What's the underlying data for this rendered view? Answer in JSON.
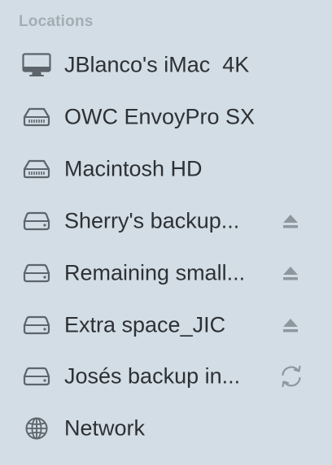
{
  "sidebar": {
    "header": "Locations",
    "items": [
      {
        "label": "JBlanco's iMac  4K",
        "icon": "imac-icon"
      },
      {
        "label": "OWC EnvoyPro SX",
        "icon": "internal-drive-icon"
      },
      {
        "label": "Macintosh HD",
        "icon": "internal-drive-icon"
      },
      {
        "label": "Sherry's backup...",
        "icon": "external-drive-icon",
        "accessory": "eject-icon"
      },
      {
        "label": "Remaining small...",
        "icon": "external-drive-icon",
        "accessory": "eject-icon"
      },
      {
        "label": "Extra space_JIC",
        "icon": "external-drive-icon",
        "accessory": "eject-icon"
      },
      {
        "label": "Josés backup in...",
        "icon": "external-drive-icon",
        "accessory": "sync-icon"
      },
      {
        "label": "Network",
        "icon": "network-globe-icon"
      }
    ]
  },
  "colors": {
    "background": "#d2dde5",
    "text": "#2d3135",
    "header_text": "#a3adb4",
    "icon": "#5d646b"
  }
}
